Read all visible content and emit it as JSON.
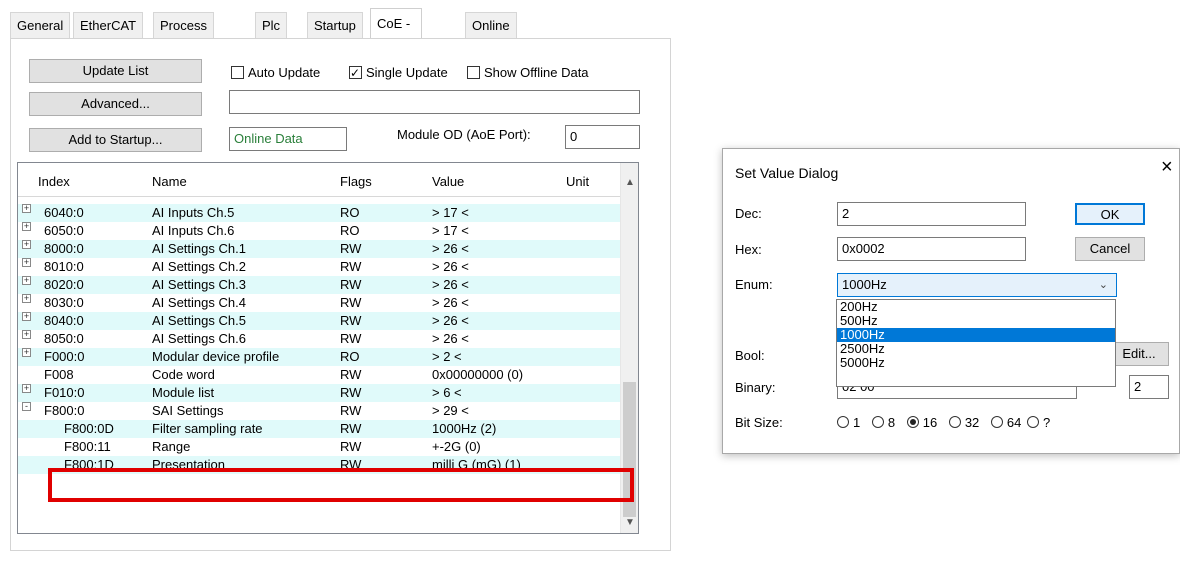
{
  "tabs": [
    "General",
    "EtherCAT",
    "Process Data",
    "Plc",
    "Startup",
    "CoE - Online",
    "Online"
  ],
  "active_tab": "CoE - Online",
  "toolbar": {
    "update_list": "Update List",
    "advanced": "Advanced...",
    "add_to_startup": "Add to Startup...",
    "auto_update": "Auto Update",
    "single_update": "Single Update",
    "show_offline": "Show Offline Data",
    "online_data": "Online Data",
    "module_od_label": "Module OD (AoE Port):",
    "module_od_value": "0"
  },
  "grid": {
    "headers": {
      "index": "Index",
      "name": "Name",
      "flags": "Flags",
      "value": "Value",
      "unit": "Unit"
    },
    "rows": [
      {
        "tree": "+",
        "index": "6040:0",
        "name": "AI Inputs Ch.5",
        "flags": "RO",
        "value": "> 17 <",
        "hl": true
      },
      {
        "tree": "+",
        "index": "6050:0",
        "name": "AI Inputs Ch.6",
        "flags": "RO",
        "value": "> 17 <",
        "hl": false
      },
      {
        "tree": "+",
        "index": "8000:0",
        "name": "AI Settings Ch.1",
        "flags": "RW",
        "value": "> 26 <",
        "hl": true
      },
      {
        "tree": "+",
        "index": "8010:0",
        "name": "AI Settings Ch.2",
        "flags": "RW",
        "value": "> 26 <",
        "hl": false
      },
      {
        "tree": "+",
        "index": "8020:0",
        "name": "AI Settings Ch.3",
        "flags": "RW",
        "value": "> 26 <",
        "hl": true
      },
      {
        "tree": "+",
        "index": "8030:0",
        "name": "AI Settings Ch.4",
        "flags": "RW",
        "value": "> 26 <",
        "hl": false
      },
      {
        "tree": "+",
        "index": "8040:0",
        "name": "AI Settings Ch.5",
        "flags": "RW",
        "value": "> 26 <",
        "hl": true
      },
      {
        "tree": "+",
        "index": "8050:0",
        "name": "AI Settings Ch.6",
        "flags": "RW",
        "value": "> 26 <",
        "hl": false
      },
      {
        "tree": "+",
        "index": "F000:0",
        "name": "Modular device profile",
        "flags": "RO",
        "value": "> 2 <",
        "hl": true
      },
      {
        "tree": "",
        "index": "F008",
        "name": "Code word",
        "flags": "RW",
        "value": "0x00000000 (0)",
        "hl": false
      },
      {
        "tree": "+",
        "index": "F010:0",
        "name": "Module list",
        "flags": "RW",
        "value": "> 6 <",
        "hl": true
      },
      {
        "tree": "-",
        "index": "F800:0",
        "name": "SAI Settings",
        "flags": "RW",
        "value": "> 29 <",
        "hl": false
      },
      {
        "tree": "",
        "index": "F800:0D",
        "name": "Filter sampling rate",
        "flags": "RW",
        "value": "1000Hz (2)",
        "hl": true
      },
      {
        "tree": "",
        "index": "F800:11",
        "name": "Range",
        "flags": "RW",
        "value": "+-2G (0)",
        "hl": false
      },
      {
        "tree": "",
        "index": "F800:1D",
        "name": "Presentation",
        "flags": "RW",
        "value": "milli G (mG) (1)",
        "hl": true
      }
    ]
  },
  "dialog": {
    "title": "Set Value Dialog",
    "dec_label": "Dec:",
    "dec_value": "2",
    "hex_label": "Hex:",
    "hex_value": "0x0002",
    "enum_label": "Enum:",
    "enum_value": "1000Hz",
    "bool_label": "Bool:",
    "binary_label": "Binary:",
    "binary_value": "02 00",
    "binary_size": "2",
    "bitsize_label": "Bit Size:",
    "ok": "OK",
    "cancel": "Cancel",
    "edit": "Edit...",
    "enum_options": [
      "200Hz",
      "500Hz",
      "1000Hz",
      "2500Hz",
      "5000Hz"
    ],
    "enum_selected_index": 2,
    "bit_sizes": [
      "1",
      "8",
      "16",
      "32",
      "64",
      "?"
    ],
    "bit_size_selected": "16"
  }
}
